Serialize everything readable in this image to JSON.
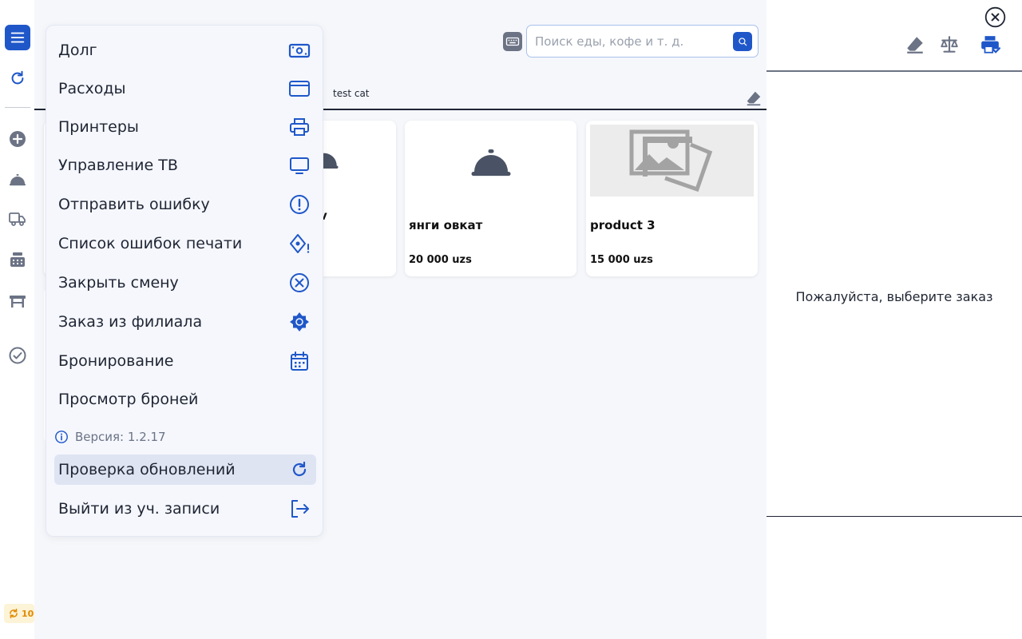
{
  "search": {
    "placeholder": "Поиск еды, кофе и т. д."
  },
  "tabs": {
    "active_label": "test cat"
  },
  "products": [
    {
      "name": "янги овкат",
      "price": "20 000 uzs",
      "image": "food-cloche-icon"
    },
    {
      "name": "product 3",
      "price": "15 000 uzs",
      "image": "image-placeholder-icon"
    }
  ],
  "hidden_card_fragment": "v",
  "order_panel": {
    "empty_message": "Пожалуйста, выберите заказ"
  },
  "sync": {
    "count": "10"
  },
  "menu": {
    "items": [
      {
        "label": "Долг",
        "icon": "cash-icon"
      },
      {
        "label": "Расходы",
        "icon": "card-icon"
      },
      {
        "label": "Принтеры",
        "icon": "printer-icon"
      },
      {
        "label": "Управление ТВ",
        "icon": "tv-icon"
      },
      {
        "label": "Отправить ошибку",
        "icon": "alert-icon"
      },
      {
        "label": "Список ошибок печати",
        "icon": "print-error-icon"
      },
      {
        "label": "Закрыть смену",
        "icon": "close-circle-icon"
      },
      {
        "label": "Заказ из филиала",
        "icon": "branch-icon"
      },
      {
        "label": "Бронирование",
        "icon": "calendar-icon"
      },
      {
        "label": "Просмотр броней",
        "icon": ""
      }
    ],
    "version": "Версия: 1.2.17",
    "check_updates": "Проверка обновлений",
    "logout": "Выйти из уч. записи"
  },
  "colors": {
    "accent": "#1f57c9",
    "icon_gray": "#6b7385",
    "warning": "#e08b00"
  }
}
